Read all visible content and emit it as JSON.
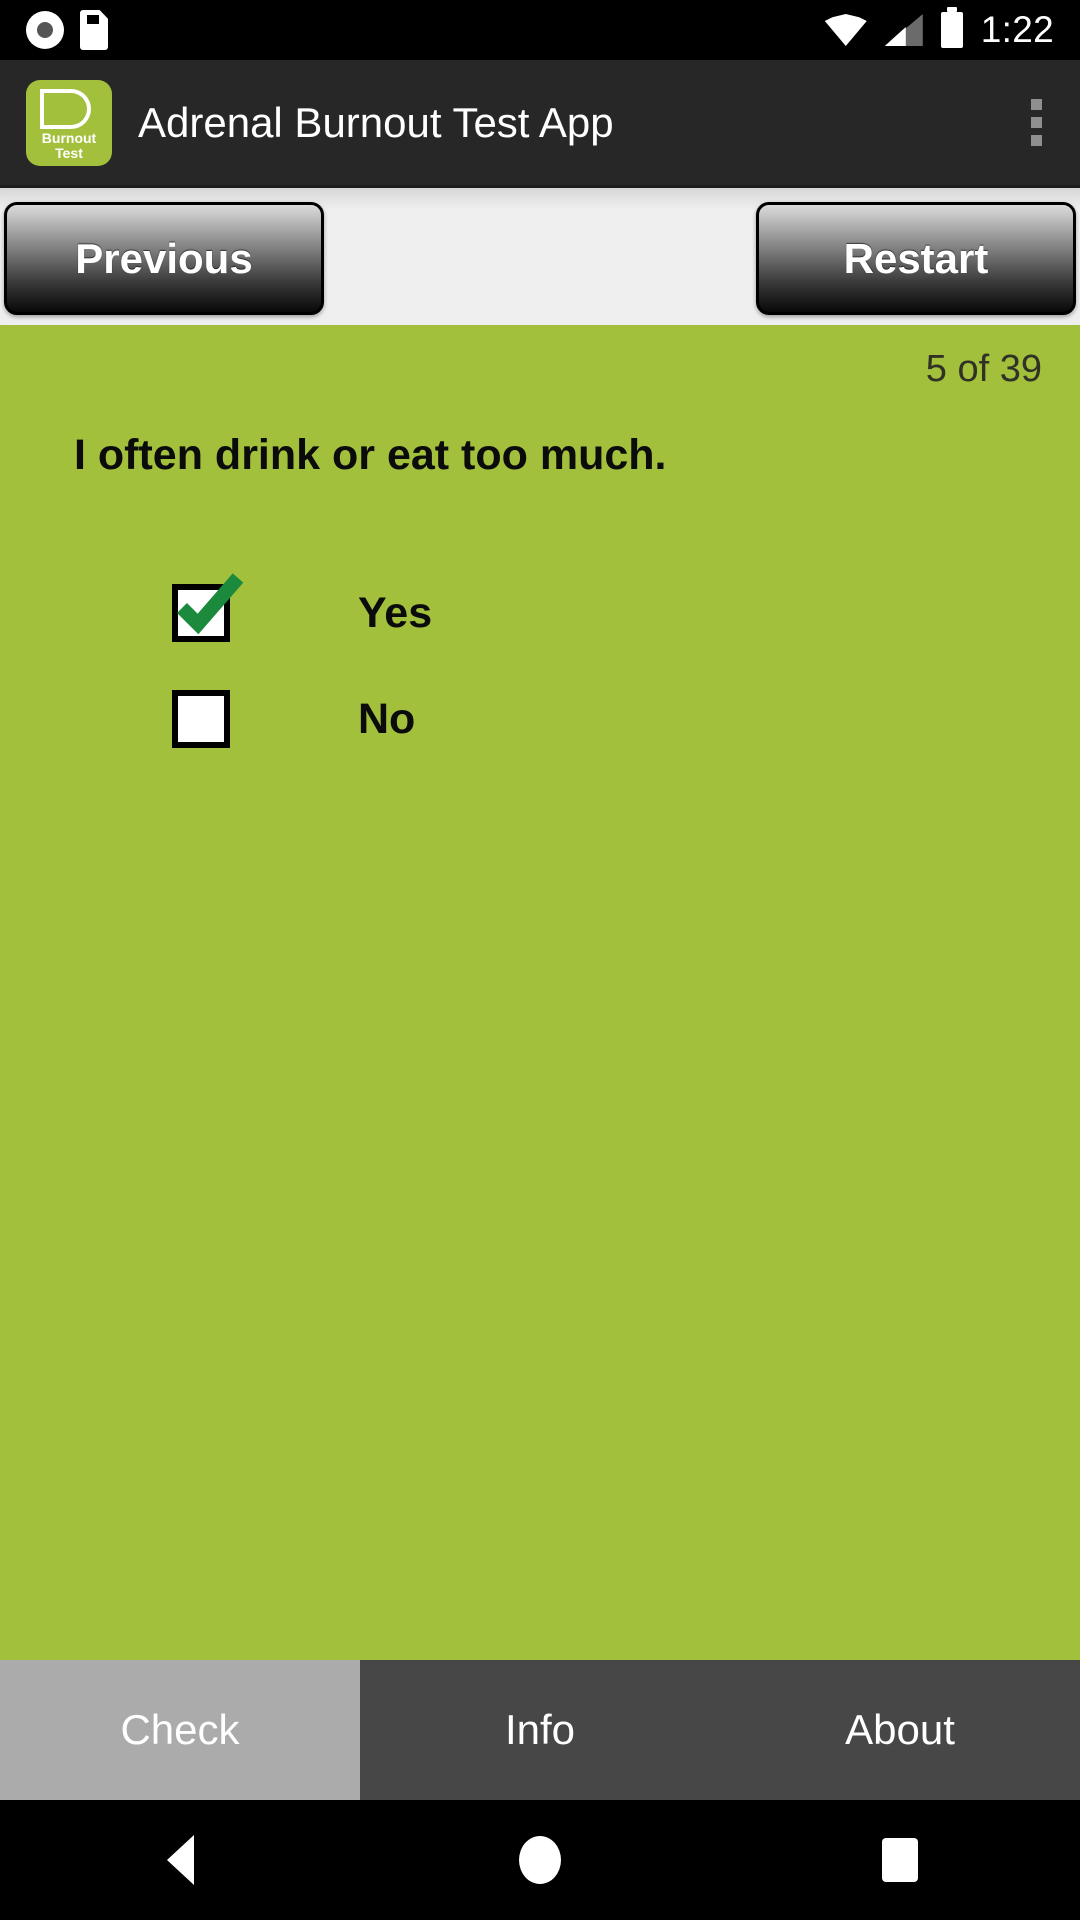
{
  "statusbar": {
    "icons_left": [
      "record-icon",
      "sdcard-icon"
    ],
    "icons_right": [
      "wifi-icon",
      "signal-icon",
      "battery-icon"
    ],
    "time": "1:22"
  },
  "appbar": {
    "logo": {
      "line1": "Burnout",
      "line2": "Test",
      "color": "#A2C03C"
    },
    "title": "Adrenal Burnout Test App",
    "overflow_icon": "overflow-menu-icon"
  },
  "navbuttons": {
    "previous_label": "Previous",
    "restart_label": "Restart"
  },
  "content": {
    "counter": "5 of 39",
    "question": "I often drink or eat too much.",
    "background_color": "#A2C03C",
    "options": [
      {
        "label": "Yes",
        "checked": true
      },
      {
        "label": "No",
        "checked": false
      }
    ]
  },
  "tabbar": {
    "tabs": [
      {
        "label": "Check",
        "active": true
      },
      {
        "label": "Info",
        "active": false
      },
      {
        "label": "About",
        "active": false
      }
    ],
    "active_color": "#ababab",
    "inactive_color": "#474747"
  },
  "sysnav": {
    "back_icon": "back-triangle-icon",
    "home_icon": "home-circle-icon",
    "recent_icon": "recents-square-icon"
  }
}
